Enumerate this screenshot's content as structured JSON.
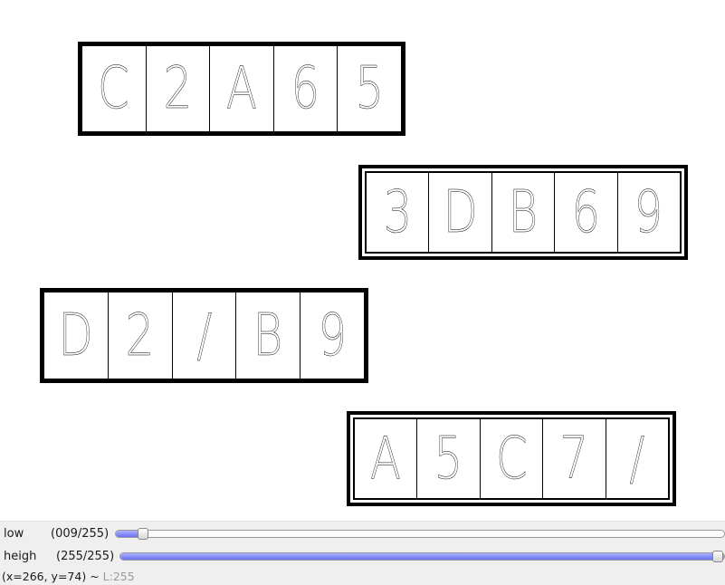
{
  "window_canvas": {
    "boxes": [
      {
        "chars": [
          "C",
          "2",
          "A",
          "6",
          "5"
        ]
      },
      {
        "chars": [
          "3",
          "D",
          "B",
          "6",
          "9"
        ]
      },
      {
        "chars": [
          "D",
          "2",
          "/",
          "B",
          "9"
        ]
      },
      {
        "chars": [
          "A",
          "5",
          "C",
          "7",
          "/"
        ]
      }
    ]
  },
  "trackbars": [
    {
      "name": "low",
      "value_text": "(009/255)",
      "value": 9,
      "max": 255
    },
    {
      "name": "heigh",
      "value_text": "(255/255)",
      "value": 255,
      "max": 255
    }
  ],
  "status": {
    "coords": "(x=266, y=74)",
    "sep": "~",
    "level": "L:255"
  }
}
